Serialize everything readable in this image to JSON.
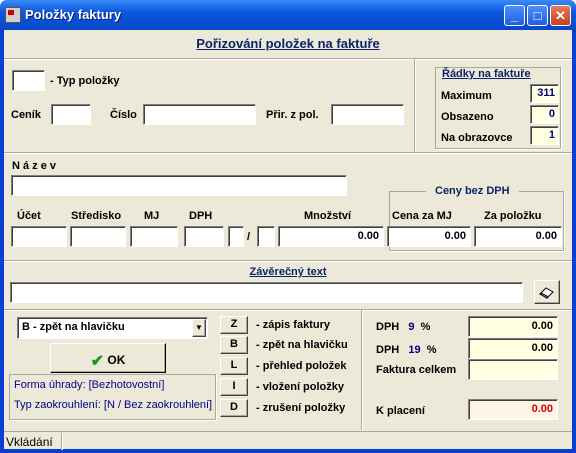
{
  "window": {
    "title": "Položky faktury",
    "minimize": "_",
    "maximize": "□",
    "close": "✕"
  },
  "header": {
    "title": "Pořizování položek na faktuře"
  },
  "top": {
    "item_type_value": "",
    "item_type_label": "- Typ položky",
    "pricelist_label": "Ceník",
    "pricelist_value": "",
    "number_label": "Číslo",
    "number_value": "",
    "assign_label": "Přir. z pol.",
    "assign_value": ""
  },
  "rows": {
    "title": "Řádky na faktuře",
    "maximum_label": "Maximum",
    "maximum_value": "311",
    "occupied_label": "Obsazeno",
    "occupied_value": "0",
    "screen_label": "Na obrazovce",
    "screen_value": "1"
  },
  "name": {
    "label": "N á z e v",
    "value": ""
  },
  "prices": {
    "title": "Ceny bez DPH"
  },
  "columns": {
    "account": "Účet",
    "center": "Středisko",
    "mj": "MJ",
    "dph": "DPH",
    "quantity": "Množství",
    "unit_price": "Cena za MJ",
    "per_item": "Za položku"
  },
  "values": {
    "account": "",
    "center": "",
    "mj": "",
    "dph": "",
    "dph_a": "",
    "slash": "/",
    "dph_b": "",
    "quantity": "0.00",
    "unit_price": "0.00",
    "per_item": "0.00"
  },
  "final_text": {
    "label": "Závěrečný text",
    "value": ""
  },
  "action": {
    "select_value": "B - zpět na hlavičku",
    "ok_label": "OK"
  },
  "info": {
    "payment": "Forma úhrady: [Bezhotovostní]",
    "rounding": "Typ zaokrouhlení: [N / Bez zaokrouhlení]"
  },
  "shortcuts": [
    {
      "key": "Z",
      "label": "- zápis faktury"
    },
    {
      "key": "B",
      "label": "- zpět na hlavičku"
    },
    {
      "key": "L",
      "label": "- přehled položek"
    },
    {
      "key": "I",
      "label": "- vložení položky"
    },
    {
      "key": "D",
      "label": "- zrušení položky"
    }
  ],
  "totals": {
    "dph_label": "DPH",
    "dph9_rate": "9",
    "dph19_rate": "19",
    "pct": "%",
    "dph9_value": "0.00",
    "dph19_value": "0.00",
    "total_label": "Faktura celkem",
    "total_value": "",
    "pay_label": "K placení",
    "pay_value": "0.00"
  },
  "statusbar": {
    "mode": "Vkládání"
  },
  "colors": {
    "title_blue": "#0a246a",
    "rate_blue": "#00008b",
    "pay_red": "#d40000"
  }
}
